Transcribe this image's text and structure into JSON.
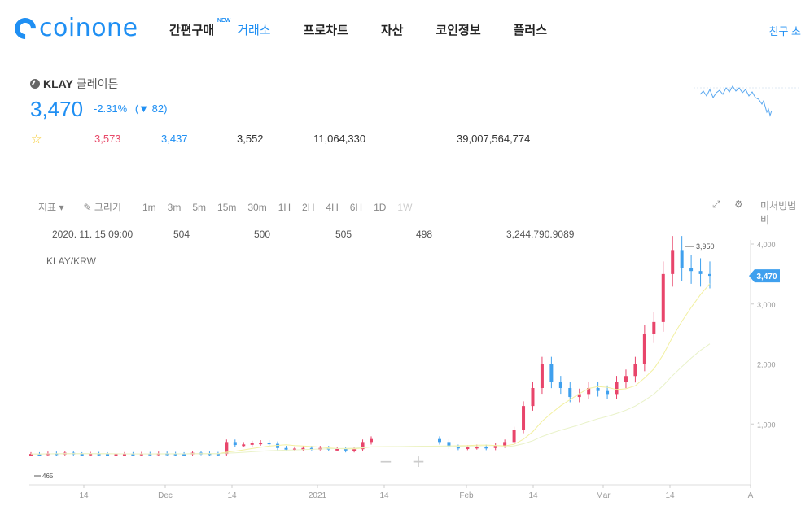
{
  "header": {
    "logo_text": "coinone",
    "nav": [
      {
        "label": "간편구매",
        "badge": "NEW"
      },
      {
        "label": "거래소",
        "active": true
      },
      {
        "label": "프로차트"
      },
      {
        "label": "자산"
      },
      {
        "label": "코인정보"
      },
      {
        "label": "플러스"
      }
    ],
    "friend_link": "친구 초"
  },
  "coin": {
    "symbol": "KLAY",
    "name_kr": "클레이튼",
    "price": "3,470",
    "change_pct": "-2.31%",
    "change_abs": "82",
    "high": "3,573",
    "low": "3,437",
    "prev_close": "3,552",
    "volume": "11,064,330",
    "amount": "39,007,564,774"
  },
  "toolbar": {
    "indicator": "지표",
    "draw": "그리기",
    "intervals": [
      "1m",
      "3m",
      "5m",
      "15m",
      "30m",
      "1H",
      "2H",
      "4H",
      "6H",
      "1D",
      "1W"
    ],
    "right_label": "미처빙법비"
  },
  "ohlc": {
    "time": "2020. 11. 15 09:00",
    "open": "504",
    "high": "500",
    "low": "505",
    "close": "498",
    "volume": "3,244,790.9089"
  },
  "chart_data": {
    "type": "candlestick",
    "pair": "KLAY/KRW",
    "current_price_tag": "3,470",
    "max_annotation": "3,950",
    "min_annotation": "465",
    "y_ticks": [
      "4,000",
      "3,000",
      "2,000",
      "1,000"
    ],
    "x_ticks": [
      "14",
      "Dec",
      "14",
      "2021",
      "14",
      "Feb",
      "14",
      "Mar",
      "14",
      "A"
    ],
    "colors": {
      "up": "#e8456b",
      "down": "#3fa0ee",
      "ma_short": "#f2f0a0",
      "ma_long": "#e9f2c8",
      "tag": "#3fa0ee"
    },
    "candles_approx_close": [
      500,
      495,
      510,
      505,
      520,
      500,
      498,
      505,
      500,
      495,
      498,
      502,
      500,
      505,
      498,
      510,
      505,
      500,
      498,
      520,
      510,
      505,
      500,
      700,
      650,
      660,
      680,
      690,
      670,
      600,
      580,
      590,
      600,
      595,
      600,
      580,
      585,
      560,
      580,
      700,
      750,
      700,
      620,
      600,
      610,
      620,
      600,
      640,
      700,
      900,
      1300,
      1600,
      2000,
      1700,
      1600,
      1450,
      1500,
      1600,
      1550,
      1500,
      1700,
      1800,
      2000,
      2500,
      2700,
      3500,
      3900,
      3600,
      3550,
      3500,
      3470
    ]
  }
}
